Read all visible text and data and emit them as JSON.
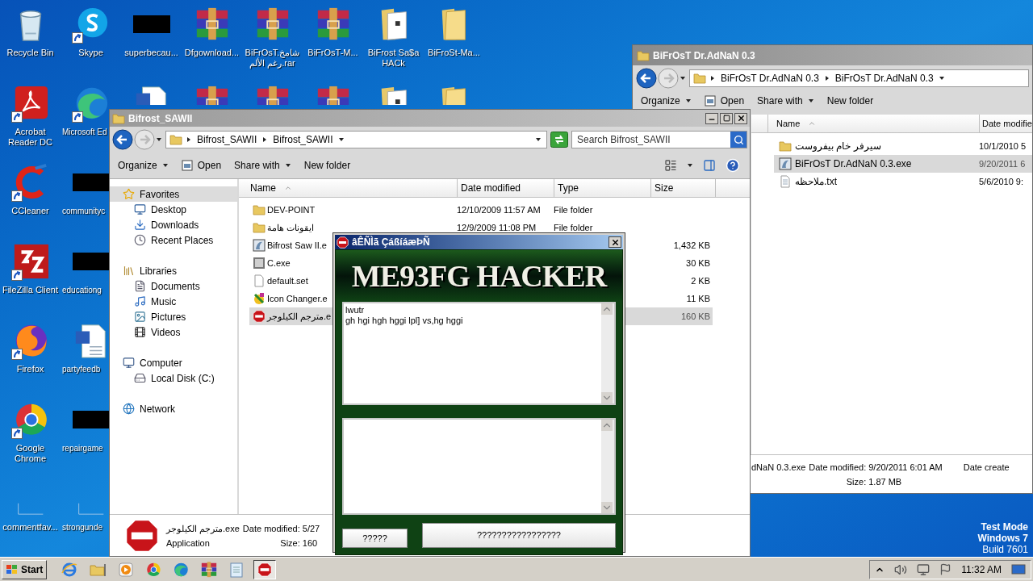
{
  "desktop": {
    "columns": [
      [
        {
          "label": "Recycle Bin",
          "kind": "recycle",
          "shortcut": false
        },
        {
          "label": "Acrobat Reader DC",
          "kind": "acrobat",
          "shortcut": true
        },
        {
          "label": "CCleaner",
          "kind": "ccleaner",
          "shortcut": true
        },
        {
          "label": "FileZilla Client",
          "kind": "filezilla",
          "shortcut": true
        },
        {
          "label": "Firefox",
          "kind": "firefox",
          "shortcut": true
        },
        {
          "label": "Google Chrome",
          "kind": "chrome",
          "shortcut": true
        },
        {
          "label": "commentfav...",
          "kind": "blank",
          "shortcut": false
        }
      ],
      [
        {
          "label": "Skype",
          "kind": "skype",
          "shortcut": true
        },
        {
          "label": "Microsoft Ed",
          "kind": "edge",
          "shortcut": true
        },
        {
          "label": "communityc",
          "kind": "redacted",
          "shortcut": false
        },
        {
          "label": "educationg",
          "kind": "redacted",
          "shortcut": false
        },
        {
          "label": "partyfeedb",
          "kind": "doc",
          "shortcut": false
        },
        {
          "label": "repairgame",
          "kind": "redacted",
          "shortcut": false
        },
        {
          "label": "strongunde",
          "kind": "blank",
          "shortcut": false
        }
      ],
      [
        {
          "label": "superbecau...",
          "kind": "redacted",
          "shortcut": false
        },
        {
          "kind": "doc",
          "shortcut": false
        }
      ],
      [
        {
          "label": "Dfgownload...",
          "kind": "rar",
          "shortcut": false
        },
        {
          "kind": "rar",
          "shortcut": false
        }
      ],
      [
        {
          "label": "BiFrOsT.شامخ رغم الألم.rar",
          "kind": "rar",
          "shortcut": false
        },
        {
          "kind": "rar",
          "shortcut": false
        }
      ],
      [
        {
          "label": "BiFrOsT-M...",
          "kind": "rar",
          "shortcut": false
        },
        {
          "kind": "rar",
          "shortcut": false
        }
      ],
      [
        {
          "label": "BiFrost Sa$a HACk",
          "kind": "folder_doc",
          "shortcut": false
        },
        {
          "kind": "folder_doc",
          "shortcut": false
        }
      ],
      [
        {
          "label": "BiFroSt-Ma...",
          "kind": "folder",
          "shortcut": false
        },
        {
          "kind": "folder",
          "shortcut": false
        }
      ]
    ],
    "os_notice": [
      "Test Mode",
      "Windows 7",
      "Build 7601"
    ]
  },
  "right_explorer": {
    "title": "BiFrOsT Dr.AdNaN 0.3",
    "breadcrumb": [
      "BiFrOsT Dr.AdNaN 0.3",
      "BiFrOsT Dr.AdNaN 0.3"
    ],
    "toolbar": [
      {
        "label": "Organize",
        "kind": "menu"
      },
      {
        "label": "Open",
        "kind": "open"
      },
      {
        "label": "Share with",
        "kind": "menu"
      },
      {
        "label": "New folder",
        "kind": "plain"
      }
    ],
    "columns": [
      "Name",
      "Date modifie"
    ],
    "files": [
      {
        "name": "سيرفر خام بيفروست",
        "date": "10/1/2010 5",
        "kind": "folder",
        "selected": false
      },
      {
        "name": "BiFrOsT Dr.AdNaN 0.3.exe",
        "date": "9/20/2011 6",
        "kind": "app",
        "selected": true
      },
      {
        "name": "ملاحظه.txt",
        "date": "5/6/2010 9:",
        "kind": "txt",
        "selected": false
      }
    ],
    "details": {
      "name": "dNaN 0.3.exe",
      "fields": [
        {
          "label": "Date modified:",
          "value": "9/20/2011 6:01 AM"
        },
        {
          "label": "Size:",
          "value": "1.87 MB"
        }
      ],
      "more_label": "Date create"
    }
  },
  "left_explorer": {
    "title": "Bifrost_SAWII",
    "breadcrumb": [
      "Bifrost_SAWII",
      "Bifrost_SAWII"
    ],
    "search": {
      "placeholder": "Search Bifrost_SAWII"
    },
    "toolbar": [
      {
        "label": "Organize",
        "kind": "menu"
      },
      {
        "label": "Open",
        "kind": "open"
      },
      {
        "label": "Share with",
        "kind": "menu"
      },
      {
        "label": "New folder",
        "kind": "plain"
      }
    ],
    "nav": [
      {
        "label": "Favorites",
        "kind": "star",
        "selected": true,
        "children": [
          {
            "label": "Desktop",
            "kind": "desktop",
            "selected": false
          },
          {
            "label": "Downloads",
            "kind": "downloads",
            "selected": false
          },
          {
            "label": "Recent Places",
            "kind": "recent",
            "selected": false
          }
        ]
      },
      {
        "label": "Libraries",
        "kind": "library",
        "selected": false,
        "children": [
          {
            "label": "Documents",
            "kind": "documents",
            "selected": false
          },
          {
            "label": "Music",
            "kind": "music",
            "selected": false
          },
          {
            "label": "Pictures",
            "kind": "pictures",
            "selected": false
          },
          {
            "label": "Videos",
            "kind": "videos",
            "selected": false
          }
        ]
      },
      {
        "label": "Computer",
        "kind": "computer",
        "selected": false,
        "children": [
          {
            "label": "Local Disk (C:)",
            "kind": "disk",
            "selected": false
          }
        ]
      },
      {
        "label": "Network",
        "kind": "network",
        "selected": false
      }
    ],
    "columns": [
      "Name",
      "Date modified",
      "Type",
      "Size"
    ],
    "files": [
      {
        "name": "DEV-POINT",
        "date": "12/10/2009 11:57 AM",
        "type": "File folder",
        "kind": "folder",
        "selected": false
      },
      {
        "name": "ايقونات هامة",
        "date": "12/9/2009 11:08 PM",
        "type": "File folder",
        "kind": "folder",
        "selected": false
      },
      {
        "name": "Bifrost Saw II.e",
        "size": "1,432 KB",
        "kind": "app",
        "selected": false
      },
      {
        "name": "C.exe",
        "size": "30 KB",
        "kind": "exe",
        "selected": false
      },
      {
        "name": "default.set",
        "size": "2 KB",
        "kind": "file",
        "selected": false
      },
      {
        "name": "Icon Changer.e",
        "size": "11 KB",
        "kind": "tool",
        "selected": false
      },
      {
        "name": "مترجم الكيلوجر.e",
        "size": "160 KB",
        "kind": "stop",
        "selected": true
      }
    ],
    "details": {
      "name": "مترجم الكيلوجر.exe",
      "type": "Application",
      "fields": [
        {
          "label": "Date modified:",
          "value": "5/27"
        },
        {
          "label": "Size:",
          "value": "160"
        }
      ]
    }
  },
  "dialog": {
    "title": "âÊÑÌã ÇáßíáæÞÑ",
    "banner": "ME93FG HACKER",
    "log_text": "lwutr\ngh hgi hgh hggi lpl] vs,hg hggi",
    "buttons": [
      "?????",
      "?????????????????"
    ]
  },
  "taskbar": {
    "start": "Start",
    "quick_launch": [
      {
        "kind": "ie"
      },
      {
        "kind": "explorer"
      },
      {
        "kind": "media"
      },
      {
        "kind": "chrome"
      },
      {
        "kind": "edge"
      },
      {
        "kind": "rar"
      },
      {
        "kind": "notepad"
      }
    ],
    "tasks": [
      {
        "kind": "stop",
        "selected": true
      }
    ],
    "clock": "11:32 AM"
  }
}
